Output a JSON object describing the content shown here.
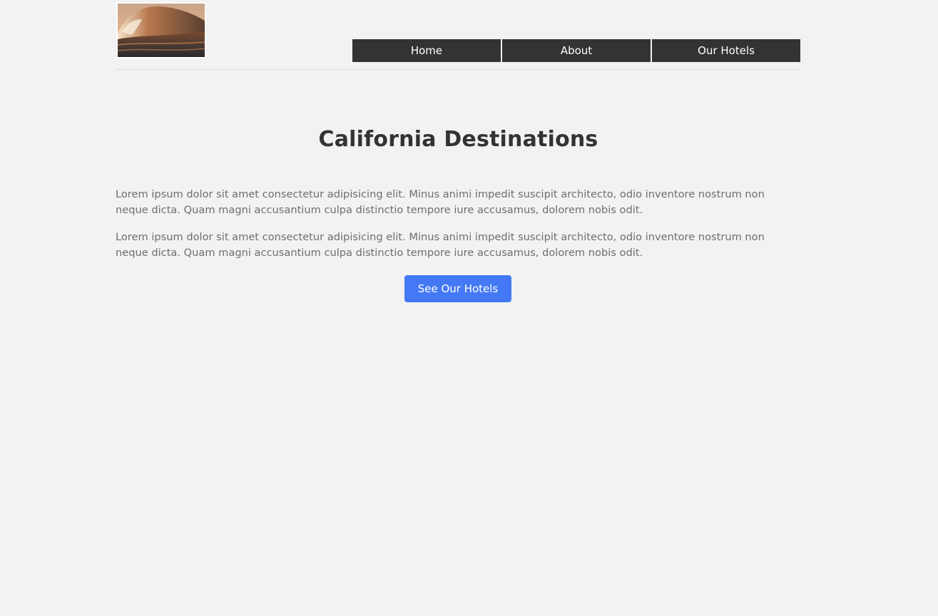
{
  "header": {
    "logo": {
      "icon": "wave-photo-logo"
    },
    "nav": {
      "items": [
        {
          "label": "Home"
        },
        {
          "label": "About"
        },
        {
          "label": "Our Hotels"
        }
      ]
    }
  },
  "main": {
    "title": "California Destinations",
    "paragraphs": [
      "Lorem ipsum dolor sit amet consectetur adipisicing elit. Minus animi impedit suscipit architecto, odio inventore nostrum non neque dicta. Quam magni accusantium culpa distinctio tempore iure accusamus, dolorem nobis odit.",
      "Lorem ipsum dolor sit amet consectetur adipisicing elit. Minus animi impedit suscipit architecto, odio inventore nostrum non neque dicta. Quam magni accusantium culpa distinctio tempore iure accusamus, dolorem nobis odit."
    ],
    "cta_label": "See Our Hotels"
  },
  "colors": {
    "background": "#f2f2f2",
    "nav_background": "#333333",
    "accent": "#4479f5",
    "title": "#333333",
    "body_text": "#6e6e6e"
  }
}
